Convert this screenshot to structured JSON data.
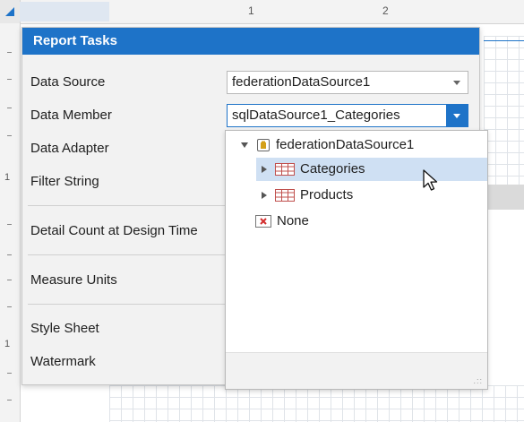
{
  "ruler": {
    "numbers": [
      "1",
      "2"
    ],
    "left_number": "1"
  },
  "panel": {
    "title": "Report Tasks",
    "rows": {
      "data_source": "Data Source",
      "data_member": "Data Member",
      "data_adapter": "Data Adapter",
      "filter_string": "Filter String",
      "detail_count": "Detail Count at Design Time",
      "measure_units": "Measure Units",
      "style_sheet": "Style Sheet",
      "watermark": "Watermark"
    },
    "data_source_value": "federationDataSource1",
    "data_member_value": "sqlDataSource1_Categories"
  },
  "dropdown": {
    "root": "federationDataSource1",
    "items": [
      "Categories",
      "Products"
    ],
    "none": "None",
    "selected": "Categories"
  },
  "colors": {
    "accent": "#1e73c8",
    "selection": "#cfe0f3"
  },
  "icons": [
    "database-icon",
    "table-icon",
    "none-icon",
    "mouse-cursor-icon"
  ]
}
